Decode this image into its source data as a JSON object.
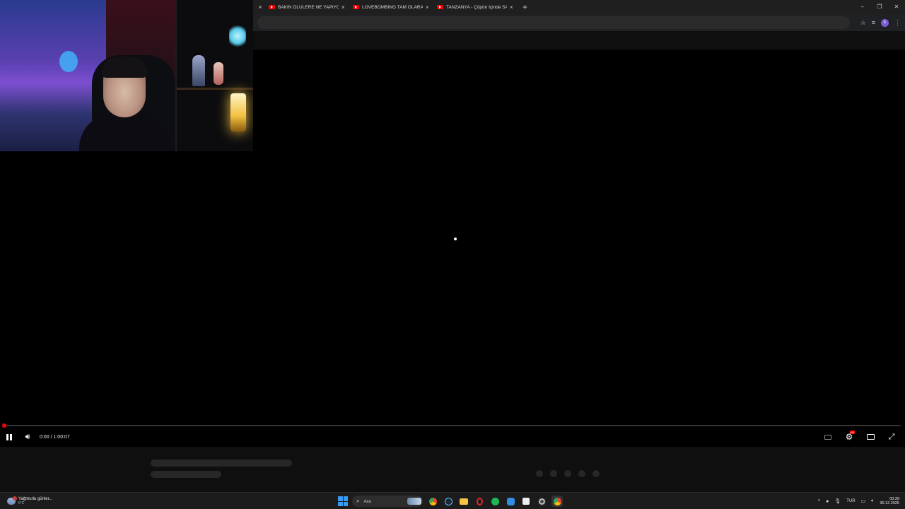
{
  "browser": {
    "tabs": [
      {
        "title": "BAKIN ÖLÜLERE NE YAPIYORLAR",
        "favicon": "youtube-icon"
      },
      {
        "title": "LOVEBOMBING TAM OLARAK NE",
        "favicon": "youtube-icon"
      },
      {
        "title": "TANZANYA - Çöpün İçinde SATI",
        "favicon": "youtube-icon"
      }
    ],
    "new_tab_icon": "+",
    "close_icon": "×",
    "window_controls": {
      "minimize": "–",
      "restore": "❐",
      "close": "✕"
    },
    "profile_initial": "k"
  },
  "player": {
    "time_display": "0:00 / 1:00:07",
    "progress_fraction": 0.0,
    "state": "playing",
    "accent_color": "#ff0000",
    "settings_badge": "HD"
  },
  "taskbar": {
    "weather_title": "Yağmurlu günler...",
    "weather_temp": "6°C",
    "search_placeholder": "Ara",
    "language": "TUR",
    "time": "00:39",
    "date": "30.12.2025"
  }
}
